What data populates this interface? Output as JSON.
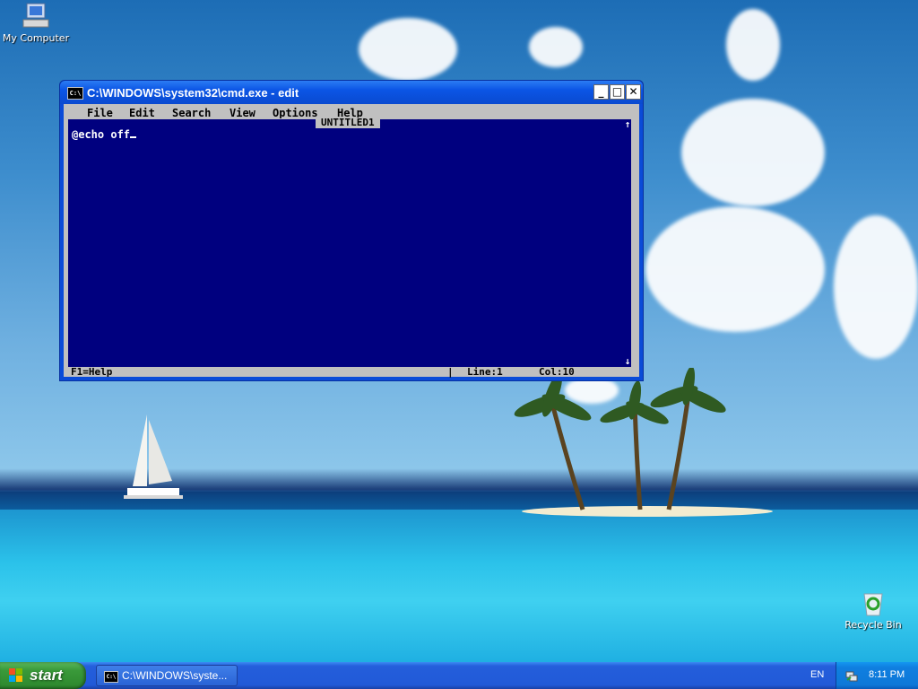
{
  "desktop": {
    "icons": [
      {
        "label": "My Computer"
      },
      {
        "label": "Recycle Bin"
      }
    ]
  },
  "window": {
    "title": "C:\\WINDOWS\\system32\\cmd.exe - edit",
    "title_icon": "C:\\",
    "buttons": {
      "minimize": "_",
      "maximize": "□",
      "close": "✕"
    },
    "menu": [
      "File",
      "Edit",
      "Search",
      "View",
      "Options",
      "Help"
    ],
    "document_name": "UNTITLED1",
    "content_line": "@echo off",
    "scroll_up": "↑",
    "scroll_down": "↓",
    "status": {
      "help": "F1=Help",
      "separator": "|",
      "line": "Line:1",
      "col": "Col:10"
    }
  },
  "taskbar": {
    "start_label": "start",
    "task_label": "C:\\WINDOWS\\syste...",
    "task_icon": "C:\\",
    "language": "EN",
    "clock": "8:11 PM"
  }
}
